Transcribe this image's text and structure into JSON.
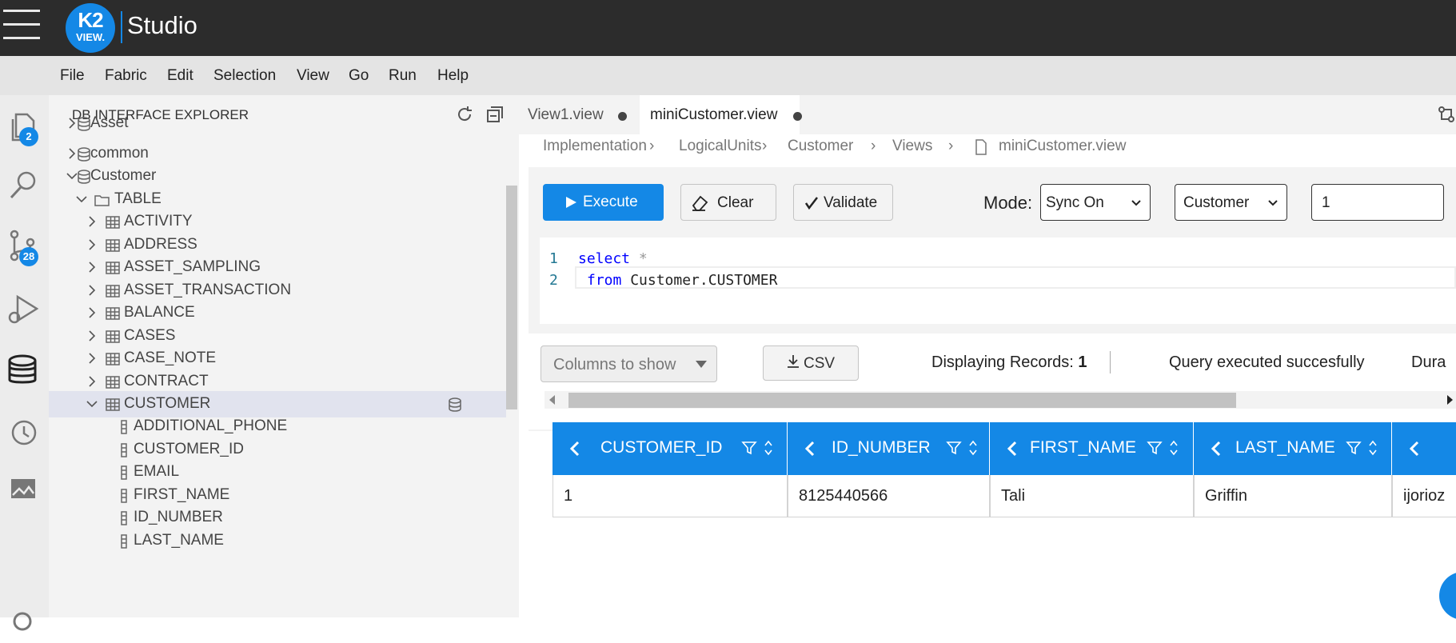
{
  "app": {
    "logo_top": "K2",
    "logo_bottom": "VIEW.",
    "title": "Studio"
  },
  "menu": [
    "File",
    "Fabric",
    "Edit",
    "Selection",
    "View",
    "Go",
    "Run",
    "Help"
  ],
  "activity": {
    "explorer_badge": "2",
    "source_control_badge": "28"
  },
  "explorer": {
    "title": "DB INTERFACE EXPLORER",
    "tree": [
      {
        "label": "Asset",
        "kind": "db"
      },
      {
        "label": "common",
        "kind": "db"
      },
      {
        "label": "Customer",
        "kind": "db"
      },
      {
        "label": "TABLE",
        "kind": "folder"
      },
      {
        "label": "ACTIVITY",
        "kind": "table"
      },
      {
        "label": "ADDRESS",
        "kind": "table"
      },
      {
        "label": "ASSET_SAMPLING",
        "kind": "table"
      },
      {
        "label": "ASSET_TRANSACTION",
        "kind": "table"
      },
      {
        "label": "BALANCE",
        "kind": "table"
      },
      {
        "label": "CASES",
        "kind": "table"
      },
      {
        "label": "CASE_NOTE",
        "kind": "table"
      },
      {
        "label": "CONTRACT",
        "kind": "table"
      },
      {
        "label": "CUSTOMER",
        "kind": "table"
      },
      {
        "label": "ADDITIONAL_PHONE",
        "kind": "column"
      },
      {
        "label": "CUSTOMER_ID",
        "kind": "column"
      },
      {
        "label": "EMAIL",
        "kind": "column"
      },
      {
        "label": "FIRST_NAME",
        "kind": "column"
      },
      {
        "label": "ID_NUMBER",
        "kind": "column"
      },
      {
        "label": "LAST_NAME",
        "kind": "column"
      }
    ]
  },
  "tabs": [
    {
      "label": "View1.view"
    },
    {
      "label": "miniCustomer.view"
    }
  ],
  "breadcrumb": [
    "Implementation",
    "LogicalUnits",
    "Customer",
    "Views",
    "miniCustomer.view"
  ],
  "toolbar": {
    "execute_label": "Execute",
    "clear_label": "Clear",
    "validate_label": "Validate",
    "mode_label": "Mode:",
    "mode_value": "Sync On",
    "lu_value": "Customer",
    "instance_value": "1"
  },
  "editor": {
    "line1_num": "1",
    "line1_kw": "select",
    "line1_rest": " *",
    "line2_num": "2",
    "line2_kw": "from",
    "line2_rest": " Customer.CUSTOMER"
  },
  "results": {
    "columns_label": "Columns to show",
    "csv_label": "CSV",
    "displaying_label": "Displaying Records:",
    "displaying_count": "1",
    "status": "Query executed succesfully",
    "duration_partial": "Dura"
  },
  "table": {
    "headers": [
      "CUSTOMER_ID",
      "ID_NUMBER",
      "FIRST_NAME",
      "LAST_NAME"
    ],
    "row": [
      "1",
      "8125440566",
      "Tali",
      "Griffin",
      "ijorioz"
    ]
  },
  "colors": {
    "accent": "#1488e6",
    "titlebar": "#2c2c2c"
  }
}
